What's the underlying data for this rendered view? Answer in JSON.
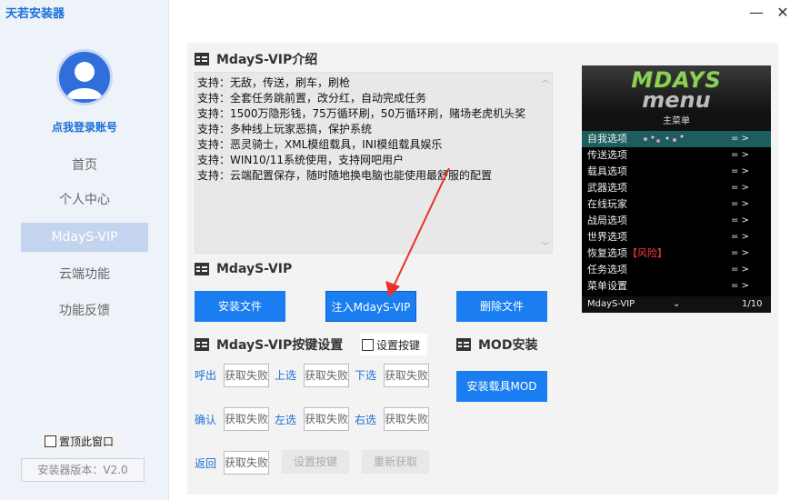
{
  "app": {
    "title": "天若安装器",
    "login_text": "点我登录账号",
    "nav": [
      "首页",
      "个人中心",
      "MdayS-VIP",
      "云端功能",
      "功能反馈"
    ],
    "pin_label": "置顶此窗口",
    "version": "安装器版本：V2.0",
    "window_controls": {
      "minimize": "—",
      "close": "✕"
    }
  },
  "intro": {
    "title": "MdayS-VIP介绍",
    "lines": [
      "支持：无敌，传送，刷车，刷枪",
      "支持：全套任务跳前置，改分红，自动完成任务",
      "支持：1500万隐形钱，75万循环刷，50万循环刷，赌场老虎机头奖",
      "支持：多种线上玩家恶搞，保护系统",
      "支持：恶灵骑士，XML模组载具，INI模组载具娱乐",
      "支持：WIN10/11系统使用，支持网吧用户",
      "支持：云端配置保存，随时随地换电脑也能使用最舒服的配置"
    ]
  },
  "vip": {
    "title": "MdayS-VIP",
    "install_label": "安装文件",
    "inject_label": "注入MdayS-VIP",
    "delete_label": "删除文件"
  },
  "keys": {
    "title": "MdayS-VIP按键设置",
    "set_keys_check": "设置按键",
    "labels": [
      "呼出",
      "上选",
      "下选",
      "确认",
      "左选",
      "右选",
      "返回"
    ],
    "box_text": "获取失败",
    "set_btn": "设置按键",
    "refresh_btn": "重新获取"
  },
  "mod": {
    "title": "MOD安装",
    "install_vehicle_label": "安装载具MOD"
  },
  "menu_preview": {
    "banner_top": "MDAYS",
    "banner_sub": "menu",
    "header": "主菜单",
    "items": [
      {
        "label": "自我选项",
        "arrow": "= >"
      },
      {
        "label": "传送选项",
        "arrow": "= >"
      },
      {
        "label": "载具选项",
        "arrow": "= >"
      },
      {
        "label": "武器选项",
        "arrow": "= >"
      },
      {
        "label": "在线玩家",
        "arrow": "= >"
      },
      {
        "label": "战局选项",
        "arrow": "= >"
      },
      {
        "label": "世界选项",
        "arrow": "= >"
      },
      {
        "label": "恢复选项",
        "warning": "【风险】",
        "arrow": "= >"
      },
      {
        "label": "任务选项",
        "arrow": "= >"
      },
      {
        "label": "菜单设置",
        "arrow": "= >"
      }
    ],
    "footer_name": "MdayS-VIP",
    "footer_chevron": "⌄",
    "footer_page": "1/10"
  },
  "colors": {
    "accent": "#1a7ef0",
    "link": "#1a6fd8",
    "menu_selected": "#1d5d5d",
    "warning": "#ff3b3b"
  }
}
